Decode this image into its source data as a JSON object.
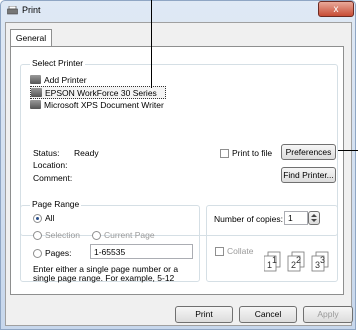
{
  "window": {
    "title": "Print",
    "close_glyph": "x"
  },
  "tabs": [
    {
      "label": "General"
    }
  ],
  "select_printer": {
    "label": "Select Printer",
    "items": [
      {
        "label": "Add Printer",
        "icon": "add-printer-icon"
      },
      {
        "label": "EPSON WorkForce 30 Series",
        "icon": "printer-icon",
        "selected": true
      },
      {
        "label": "Microsoft XPS Document Writer",
        "icon": "printer-icon"
      }
    ]
  },
  "status": {
    "status_label": "Status:",
    "status_value": "Ready",
    "location_label": "Location:",
    "comment_label": "Comment:"
  },
  "print_to_file": {
    "label": "Print to file",
    "checked": false
  },
  "preferences_button": "Preferences",
  "find_printer_button": "Find Printer...",
  "page_range": {
    "label": "Page Range",
    "all": "All",
    "selection": "Selection",
    "current_page": "Current Page",
    "pages": "Pages:",
    "pages_value": "1-65535",
    "hint": "Enter either a single page number or a single page range.  For example, 5-12"
  },
  "copies": {
    "label": "Number of copies:",
    "value": "1",
    "collate_label": "Collate",
    "collate_checked": false
  },
  "footer": {
    "print": "Print",
    "cancel": "Cancel",
    "apply": "Apply"
  },
  "colors": {
    "accent": "#2a4f8a",
    "window_frame": "#c7d7ec"
  }
}
